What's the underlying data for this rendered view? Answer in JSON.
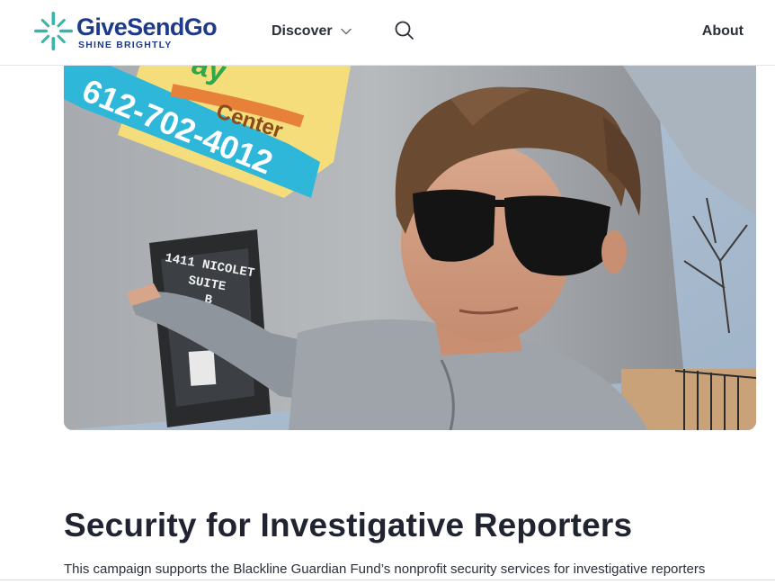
{
  "header": {
    "logo": {
      "name": "GiveSendGo",
      "tagline": "SHINE BRIGHTLY",
      "icon": "sparkle-logo-icon",
      "colors": {
        "brand": "#1d3b8a",
        "accent": "#3bb3a8"
      }
    },
    "nav": {
      "discover_label": "Discover",
      "discover_icon": "chevron-down-icon",
      "search_icon": "search-icon",
      "about_label": "About"
    }
  },
  "campaign": {
    "hero_image": {
      "sign_phone": "612-702-4012",
      "sign_word": "Center",
      "sign_partial": "ay",
      "door_address_line1": "1411 NICOLET",
      "door_address_line2": "SUITE",
      "door_address_line3": "B"
    },
    "title": "Security for Investigative Reporters",
    "description": "This campaign supports the Blackline Guardian Fund’s nonprofit security services for investigative reporters"
  }
}
